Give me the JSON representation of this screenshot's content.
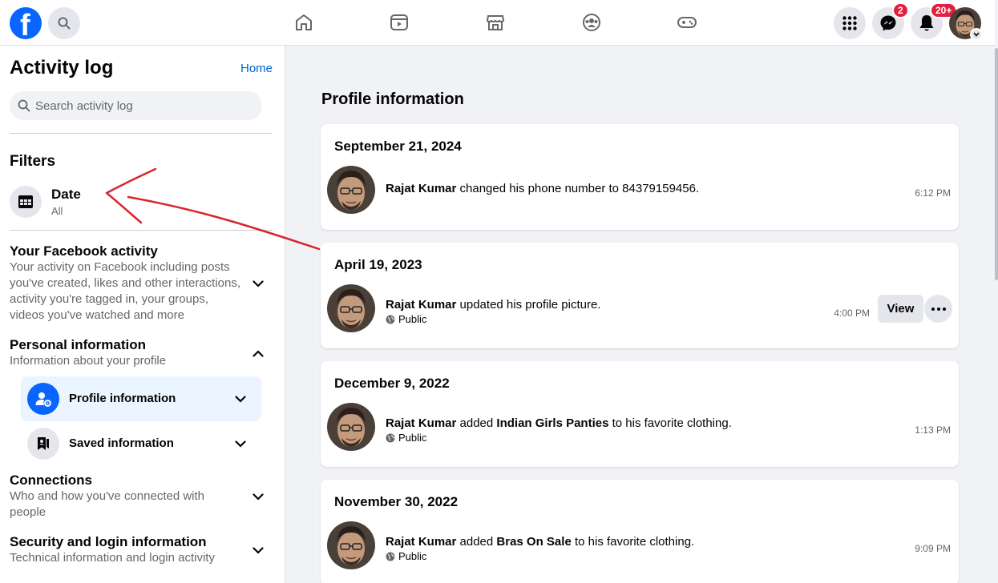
{
  "header": {
    "logo_letter": "f",
    "messenger_badge": "2",
    "notifications_badge": "20+",
    "colors": {
      "brand": "#0866ff",
      "badge": "#e41e3f"
    }
  },
  "sidebar": {
    "title": "Activity log",
    "home_link": "Home",
    "search_placeholder": "Search activity log",
    "filters_heading": "Filters",
    "date_filter": {
      "label": "Date",
      "value": "All"
    },
    "sections": [
      {
        "title": "Your Facebook activity",
        "description": "Your activity on Facebook including posts you've created, likes and other interactions, activity you're tagged in, your groups, videos you've watched and more",
        "expanded": false
      },
      {
        "title": "Personal information",
        "description": "Information about your profile",
        "expanded": true
      },
      {
        "title": "Connections",
        "description": "Who and how you've connected with people",
        "expanded": false
      },
      {
        "title": "Security and login information",
        "description": "Technical information and login activity",
        "expanded": false
      }
    ],
    "sub_items": [
      {
        "label": "Profile information",
        "icon": "profile-gear-icon",
        "active": true
      },
      {
        "label": "Saved information",
        "icon": "saved-info-icon",
        "active": false
      }
    ]
  },
  "main": {
    "heading": "Profile information",
    "entries": [
      {
        "date": "September 21, 2024",
        "actor": "Rajat Kumar",
        "text_before": " changed his phone number to 84379159456.",
        "object": "",
        "text_after": "",
        "privacy": "",
        "time": "6:12 PM",
        "has_view": false
      },
      {
        "date": "April 19, 2023",
        "actor": "Rajat Kumar",
        "text_before": " updated his profile picture.",
        "object": "",
        "text_after": "",
        "privacy": "Public",
        "time": "4:00 PM",
        "has_view": true,
        "view_label": "View"
      },
      {
        "date": "December 9, 2022",
        "actor": "Rajat Kumar",
        "text_before": " added ",
        "object": "Indian Girls Panties",
        "text_after": " to his favorite clothing.",
        "privacy": "Public",
        "time": "1:13 PM",
        "has_view": false
      },
      {
        "date": "November 30, 2022",
        "actor": "Rajat Kumar",
        "text_before": " added ",
        "object": "Bras On Sale",
        "text_after": " to his favorite clothing.",
        "privacy": "Public",
        "time": "9:09 PM",
        "has_view": false
      }
    ]
  },
  "annotation": {
    "type": "red-arrow",
    "color": "#d9262b"
  }
}
